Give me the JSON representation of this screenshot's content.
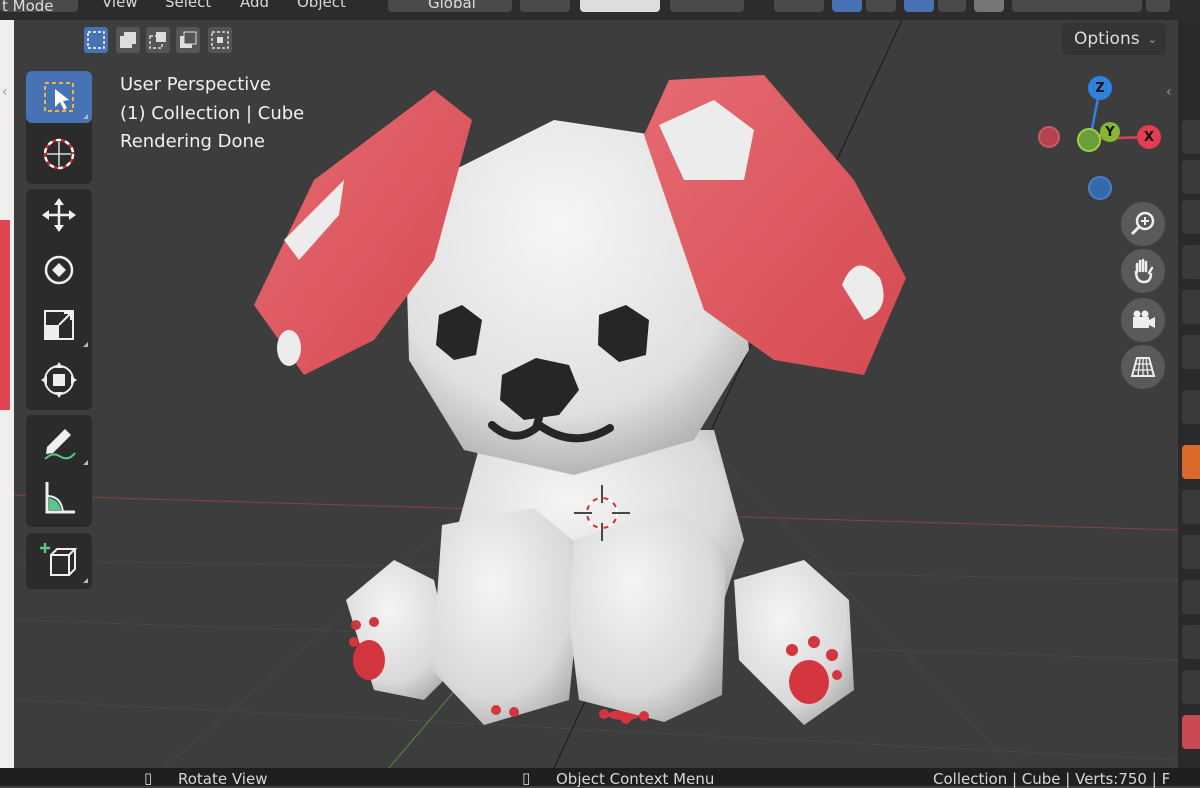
{
  "header": {
    "mode_label": "t Mode",
    "menus": [
      "View",
      "Select",
      "Add",
      "Object"
    ],
    "orientation": "Global"
  },
  "selection_modes": [
    "select-box",
    "extend",
    "subtract",
    "difference",
    "intersect"
  ],
  "toolbar": {
    "tools": [
      "select-box-icon",
      "cursor-icon",
      "move-icon",
      "rotate-icon",
      "scale-icon",
      "transform-icon",
      "annotate-icon",
      "measure-icon",
      "add-cube-icon"
    ],
    "active_tool": "select-box-icon"
  },
  "viewport": {
    "perspective": "User Perspective",
    "collection": "(1) Collection | Cube",
    "status": "Rendering Done",
    "options_label": "Options"
  },
  "gizmo": {
    "x_label": "X",
    "y_label": "Y",
    "z_label": "Z",
    "colors": {
      "x": "#e23d52",
      "y": "#86b730",
      "z": "#2f83e0"
    }
  },
  "nav_buttons": [
    "zoom-icon",
    "hand-icon",
    "camera-icon",
    "grid-icon"
  ],
  "statusbar": {
    "rotate": "Rotate View",
    "context": "Object Context Menu",
    "info": "Collection | Cube | Verts:750 | F"
  }
}
